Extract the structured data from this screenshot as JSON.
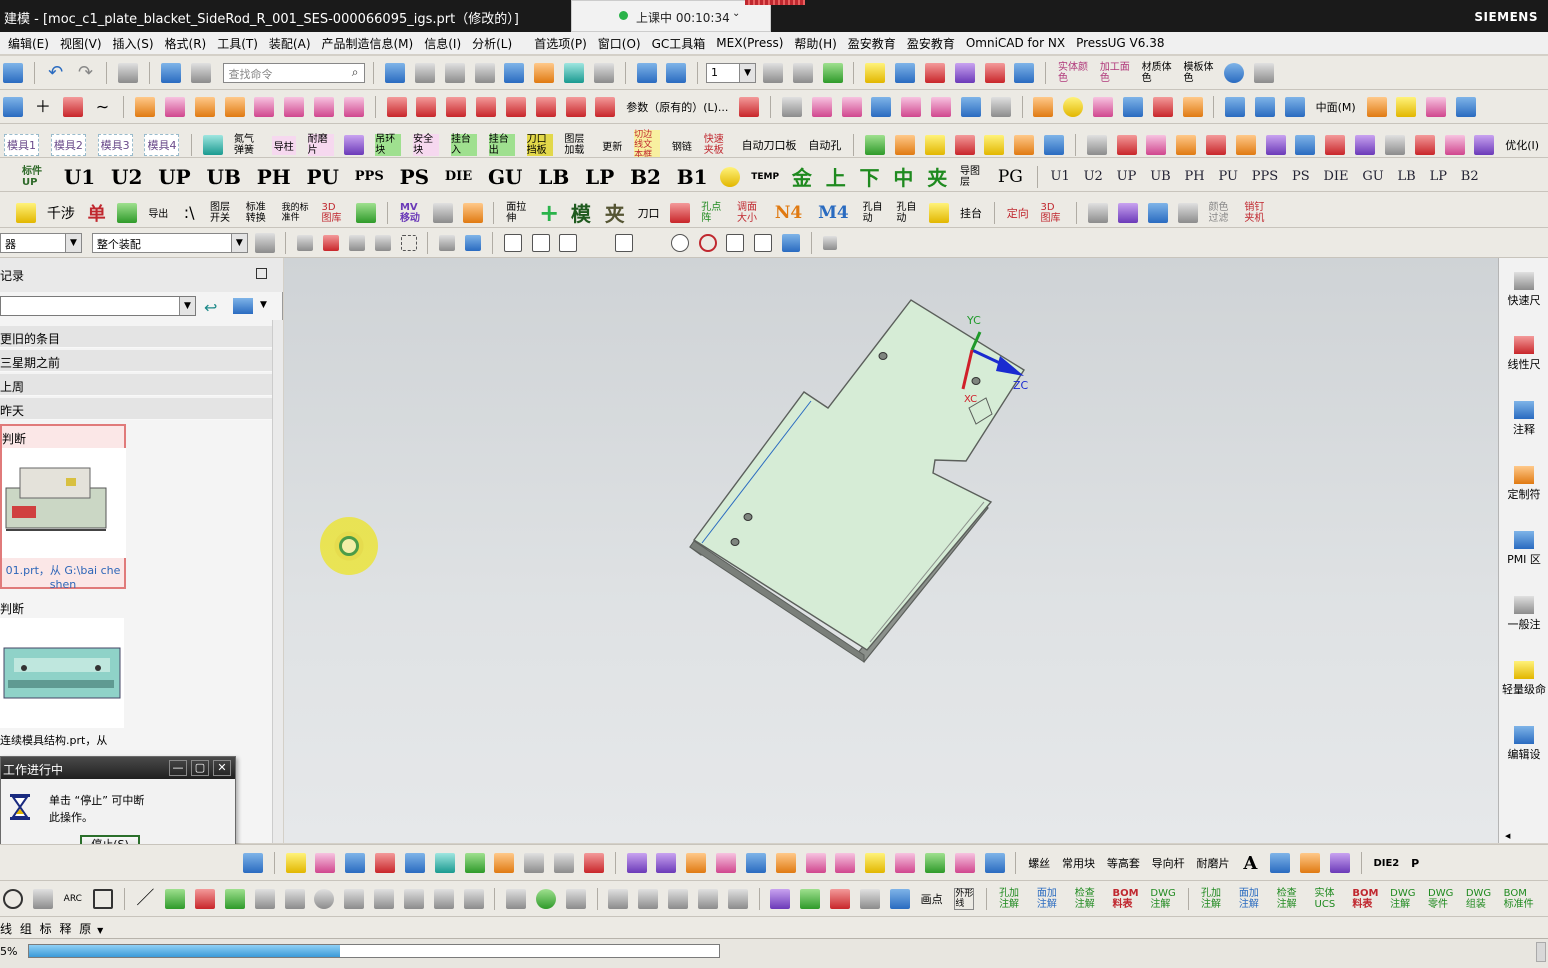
{
  "window": {
    "title": "建模 - [moc_c1_plate_blacket_SideRod_R_001_SES-000066095_igs.prt（修改的）]",
    "brand": "SIEMENS"
  },
  "timer": {
    "label": "上课中 00:10:34"
  },
  "menu": [
    "编辑(E)",
    "视图(V)",
    "插入(S)",
    "格式(R)",
    "工具(T)",
    "装配(A)",
    "产品制造信息(M)",
    "信息(I)",
    "分析(L)",
    "首选项(P)",
    "窗口(O)",
    "GC工具箱",
    "MEX(Press)",
    "帮助(H)",
    "盈安教育",
    "盈安教育",
    "OmniCAD for NX",
    "PressUG V6.38"
  ],
  "toolbar1": {
    "search_placeholder": "查找命令",
    "layer_value": "1",
    "labels": [
      "实体颜色",
      "加工面色",
      "材质体色",
      "模板体色"
    ]
  },
  "toolbar2": {
    "labels": [
      "参数（原有的）(L)...",
      "中面(M)"
    ]
  },
  "toolbar3": {
    "labels": [
      "模具1",
      "模具2",
      "模具3",
      "模具4",
      "氮气弹簧",
      "导柱",
      "耐磨片",
      "吊环块",
      "安全块",
      "挂台入",
      "挂台出",
      "刀口挡板",
      "图层加载",
      "更新",
      "切边线文本框",
      "钢链",
      "快速夹板",
      "自动刀口板",
      "自动孔",
      "优化(I)"
    ]
  },
  "toolbar4": {
    "labels": [
      "标件UP",
      "U1",
      "U2",
      "UP",
      "UB",
      "PH",
      "PU",
      "PPS",
      "PS",
      "DIE",
      "GU",
      "LB",
      "LP",
      "B2",
      "B1",
      "TEMP",
      "金",
      "上",
      "下",
      "中",
      "夹",
      "导图层",
      "PG"
    ],
    "small_labels": [
      "U1",
      "U2",
      "UP",
      "UB",
      "PH",
      "PU",
      "PPS",
      "PS",
      "DIE",
      "GU",
      "LB",
      "LP",
      "B2"
    ]
  },
  "toolbar5": {
    "labels": [
      "千涉",
      "单",
      "导出",
      "图层开关",
      "标准转换",
      "我的标准件",
      "3D图库",
      "MV移动",
      "面拉伸",
      "模",
      "夹",
      "刀口",
      "孔点阵",
      "调面大小",
      "N4",
      "M4",
      "孔自动",
      "孔自动",
      "挂台",
      "定向",
      "3D图库",
      "颜色过滤",
      "销钉夹机"
    ]
  },
  "selection": {
    "filter_value": "器",
    "scope_value": "整个装配"
  },
  "navigator": {
    "header": "记录",
    "groups": [
      "更旧的条目",
      "三星期之前",
      "上周",
      "昨天"
    ],
    "items": [
      {
        "name": "判断",
        "caption": "01.prt，从 G:\\bai che shen"
      },
      {
        "name": "判断",
        "caption": "连续模具结构.prt，从"
      }
    ]
  },
  "viewport": {
    "axes": {
      "yc": "YC",
      "zc": "ZC",
      "xc": "XC"
    }
  },
  "resource_bar": [
    "快速尺",
    "线性尺",
    "注释",
    "定制符",
    "PMI 区",
    "一般注",
    "轻量级命",
    "编辑设"
  ],
  "dialog": {
    "title": "工作进行中",
    "message_line1": "单击 “停止” 可中断",
    "message_line2": "此操作。",
    "stop_label": "停止(S)"
  },
  "bottom_toolbar1": {
    "labels": [
      "螺丝",
      "常用块",
      "等高套",
      "导向杆",
      "耐磨片",
      "DIE2",
      "P"
    ]
  },
  "bottom_toolbar2": {
    "labels": [
      "ARC",
      "画点",
      "外形线",
      "孔加注解",
      "面加注解",
      "检查注解",
      "BOM料表",
      "DWG注解",
      "孔加注解",
      "面加注解",
      "检查注解",
      "实体UCS",
      "BOM料表",
      "DWG注解",
      "DWG零件",
      "DWG组装",
      "BOM标准件"
    ]
  },
  "bottom_toolbar3": {
    "label": "线 组 标 释 原"
  },
  "status": {
    "percent": "5%",
    "progress": 0.45
  },
  "colors": {
    "part_face": "#d6ecd6",
    "part_edge": "#5b5f5b",
    "titlebar": "#1a1a1a"
  }
}
